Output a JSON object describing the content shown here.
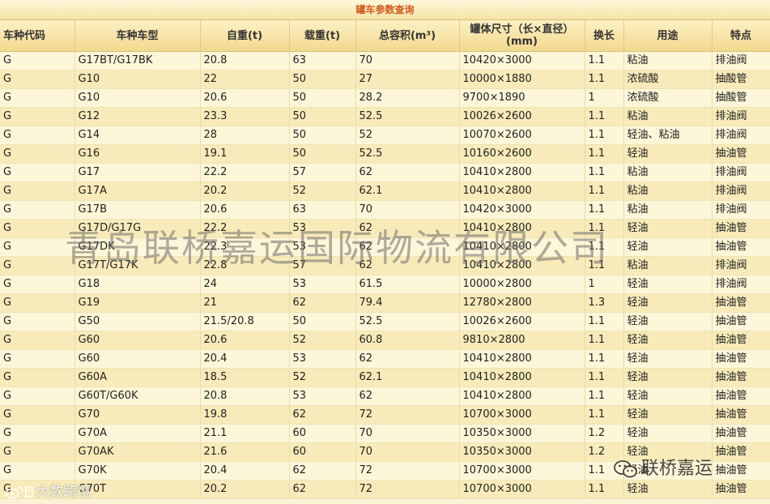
{
  "title": "罐车参数查询",
  "columns": [
    "车种代码",
    "车种车型",
    "自重(t)",
    "载重(t)",
    "总容积(m³)",
    "罐体尺寸（长×直径）(mm)",
    "换长",
    "用途",
    "特点"
  ],
  "rows": [
    [
      "G",
      "G17BT/G17BK",
      "20.8",
      "63",
      "70",
      "10420×3000",
      "1.1",
      "粘油",
      "排油阀"
    ],
    [
      "G",
      "G10",
      "22",
      "50",
      "27",
      "10000×1880",
      "1.1",
      "浓硫酸",
      "抽酸管"
    ],
    [
      "G",
      "G10",
      "20.6",
      "50",
      "28.2",
      "9700×1890",
      "1",
      "浓硫酸",
      "抽酸管"
    ],
    [
      "G",
      "G12",
      "23.3",
      "50",
      "52.5",
      "10026×2600",
      "1.1",
      "粘油",
      "排油阀"
    ],
    [
      "G",
      "G14",
      "28",
      "50",
      "52",
      "10070×2600",
      "1.1",
      "轻油、粘油",
      "排油阀"
    ],
    [
      "G",
      "G16",
      "19.1",
      "50",
      "52.5",
      "10160×2600",
      "1.1",
      "轻油",
      "抽油管"
    ],
    [
      "G",
      "G17",
      "22.2",
      "57",
      "62",
      "10410×2800",
      "1.1",
      "粘油",
      "排油阀"
    ],
    [
      "G",
      "G17A",
      "20.2",
      "52",
      "62.1",
      "10410×2800",
      "1.1",
      "粘油",
      "排油阀"
    ],
    [
      "G",
      "G17B",
      "20.6",
      "63",
      "70",
      "10420×3000",
      "1.1",
      "粘油",
      "排油阀"
    ],
    [
      "G",
      "G17D/G17G",
      "22.2",
      "53",
      "62",
      "10410×2800",
      "1.1",
      "轻油",
      "抽油管"
    ],
    [
      "G",
      "G17DK",
      "22.3",
      "53",
      "62",
      "10410×2800",
      "1.1",
      "轻油",
      "抽油管"
    ],
    [
      "G",
      "G17T/G17K",
      "22.8",
      "57",
      "62",
      "10410×2800",
      "1.1",
      "粘油",
      "排油阀"
    ],
    [
      "G",
      "G18",
      "24",
      "53",
      "61.5",
      "10000×2800",
      "1",
      "轻油",
      "排油阀"
    ],
    [
      "G",
      "G19",
      "21",
      "62",
      "79.4",
      "12780×2800",
      "1.3",
      "轻油",
      "抽油管"
    ],
    [
      "G",
      "G50",
      "21.5/20.8",
      "50",
      "52.5",
      "10026×2600",
      "1.1",
      "轻油",
      "抽油管"
    ],
    [
      "G",
      "G60",
      "20.6",
      "52",
      "60.8",
      "9810×2800",
      "1.1",
      "轻油",
      "抽油管"
    ],
    [
      "G",
      "G60",
      "20.4",
      "53",
      "62",
      "10410×2800",
      "1.1",
      "轻油",
      "抽油管"
    ],
    [
      "G",
      "G60A",
      "18.5",
      "52",
      "62.1",
      "10410×2800",
      "1.1",
      "轻油",
      "抽油管"
    ],
    [
      "G",
      "G60T/G60K",
      "20.8",
      "53",
      "62",
      "10410×2800",
      "1.1",
      "轻油",
      "抽油管"
    ],
    [
      "G",
      "G70",
      "19.8",
      "62",
      "72",
      "10700×3000",
      "1.1",
      "轻油",
      "抽油管"
    ],
    [
      "G",
      "G70A",
      "21.1",
      "60",
      "70",
      "10350×3000",
      "1.2",
      "轻油",
      "抽油管"
    ],
    [
      "G",
      "G70AK",
      "21.6",
      "60",
      "70",
      "10350×3000",
      "1.2",
      "轻油",
      "抽油管"
    ],
    [
      "G",
      "G70K",
      "20.4",
      "62",
      "72",
      "10700×3000",
      "1.1",
      "轻油",
      "抽油管"
    ],
    [
      "G",
      "G70T",
      "20.2",
      "62",
      "72",
      "10700×3000",
      "1.1",
      "轻油",
      "抽油管"
    ]
  ],
  "watermark": "青岛联桥嘉运国际物流有限公司",
  "wechat_mark": "联桥嘉运",
  "weibo_mark": "大数跨境",
  "colors": {
    "title_text": "#d25a1c",
    "header_bg": "#f1d98e",
    "row_odd": "#fdf6d8",
    "row_even": "#f8ebb9"
  }
}
